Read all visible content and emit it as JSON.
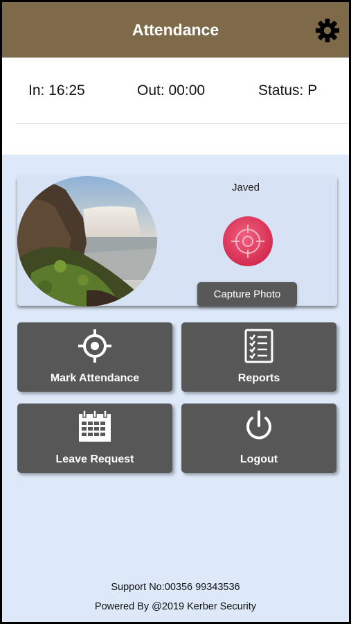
{
  "header": {
    "title": "Attendance",
    "settings_icon": "gear-icon"
  },
  "status": {
    "in": "In: 16:25",
    "out": "Out: 00:00",
    "status": "Status: P"
  },
  "profile": {
    "name": "Javed",
    "capture_label": "Capture Photo",
    "target_icon": "crosshair-icon",
    "photo_subject": "waterfall"
  },
  "tiles": [
    {
      "label": "Mark Attendance",
      "icon": "crosshair-icon"
    },
    {
      "label": "Reports",
      "icon": "checklist-icon"
    },
    {
      "label": "Leave Request",
      "icon": "calendar-icon"
    },
    {
      "label": "Logout",
      "icon": "power-icon"
    }
  ],
  "footer": {
    "support": "Support No:00356 99343536",
    "powered": "Powered By @2019 Kerber Security"
  },
  "colors": {
    "header_bg": "#7e6a48",
    "page_bg": "#dde9f8",
    "tile_bg": "#575757",
    "capture_button": "#e0345a"
  }
}
